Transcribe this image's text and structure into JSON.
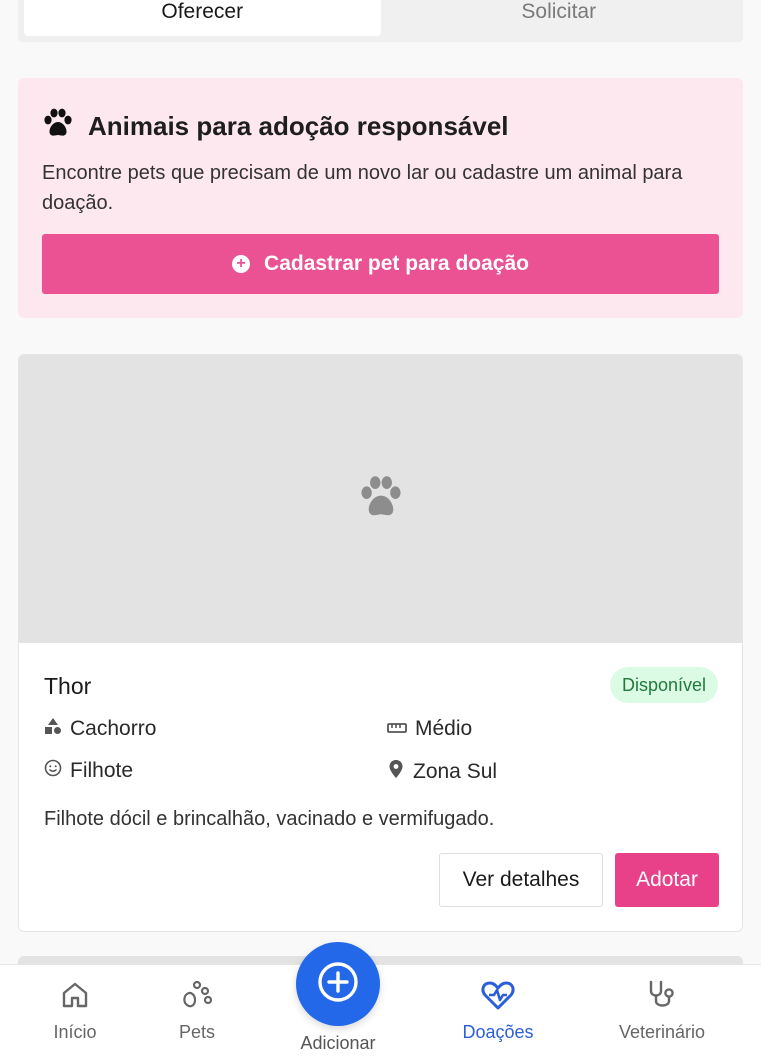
{
  "tabs": [
    {
      "label": "Oferecer",
      "active": true
    },
    {
      "label": "Solicitar",
      "active": false
    }
  ],
  "promo": {
    "icon": "paw-icon",
    "title": "Animais para adoção responsável",
    "description": "Encontre pets que precisam de um novo lar ou cadastre um animal para doação.",
    "button_label": "Cadastrar pet para doação",
    "background_color": "#fde8ef",
    "button_color": "#ea5293"
  },
  "pet": {
    "name": "Thor",
    "status": "Disponível",
    "species": "Cachorro",
    "size": "Médio",
    "age": "Filhote",
    "location": "Zona Sul",
    "description": "Filhote dócil e brincalhão, vacinado e vermifugado.",
    "details_label": "Ver detalhes",
    "adopt_label": "Adotar"
  },
  "nav": {
    "items": [
      {
        "label": "Início",
        "icon": "home-icon"
      },
      {
        "label": "Pets",
        "icon": "paw-icon"
      },
      {
        "label": "Adicionar",
        "icon": "plus-circle-icon"
      },
      {
        "label": "Doações",
        "icon": "heart-pulse-icon"
      },
      {
        "label": "Veterinário",
        "icon": "stethoscope-icon"
      }
    ],
    "active_color": "#2b5fd9",
    "fab_color": "#2468ea"
  }
}
